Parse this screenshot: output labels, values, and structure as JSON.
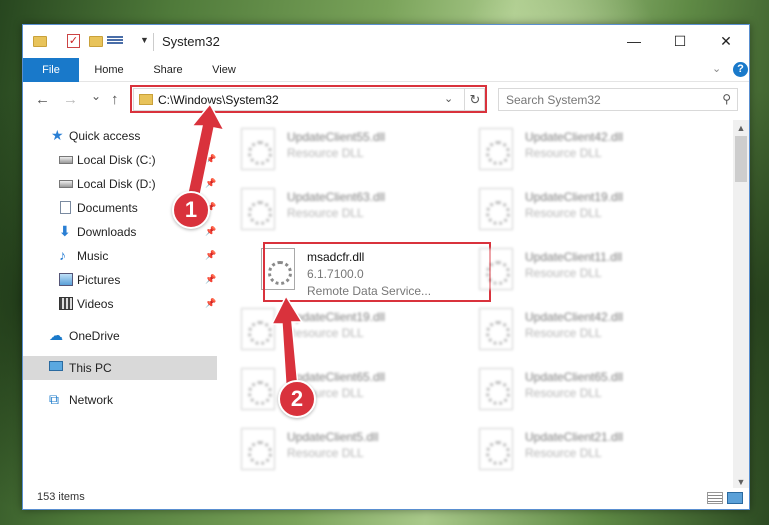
{
  "window": {
    "title": "System32",
    "minimize": "—",
    "maximize": "☐",
    "close": "✕"
  },
  "ribbon": {
    "tabs": [
      "File",
      "Home",
      "Share",
      "View"
    ],
    "help": "?"
  },
  "nav": {
    "back": "←",
    "forward": "→",
    "recent": "⌄",
    "up": "↑",
    "address": "C:\\Windows\\System32",
    "search_placeholder": "Search System32"
  },
  "sidebar": {
    "items": [
      {
        "label": "Quick access",
        "icon": "star-icon",
        "pinned": false
      },
      {
        "label": "Local Disk (C:)",
        "icon": "disk-icon",
        "pinned": true
      },
      {
        "label": "Local Disk (D:)",
        "icon": "disk-icon",
        "pinned": true
      },
      {
        "label": "Documents",
        "icon": "document-icon",
        "pinned": true
      },
      {
        "label": "Downloads",
        "icon": "download-icon",
        "pinned": true
      },
      {
        "label": "Music",
        "icon": "music-icon",
        "pinned": true
      },
      {
        "label": "Pictures",
        "icon": "pictures-icon",
        "pinned": true
      },
      {
        "label": "Videos",
        "icon": "videos-icon",
        "pinned": true
      },
      {
        "label": "OneDrive",
        "icon": "cloud-icon",
        "pinned": false
      },
      {
        "label": "This PC",
        "icon": "computer-icon",
        "pinned": false,
        "selected": true
      },
      {
        "label": "Network",
        "icon": "network-icon",
        "pinned": false
      }
    ]
  },
  "files": [
    {
      "name": "UpdateClient55.dll",
      "desc": "Resource DLL",
      "blurred": true
    },
    {
      "name": "UpdateClient42.dll",
      "desc": "Resource DLL",
      "blurred": true
    },
    {
      "name": "UpdateClient63.dll",
      "desc": "Resource DLL",
      "blurred": true
    },
    {
      "name": "UpdateClient19.dll",
      "desc": "Resource DLL",
      "blurred": true
    },
    {
      "name": "msadcfr.dll",
      "version": "6.1.7100.0",
      "desc": "Remote Data Service...",
      "blurred": false
    },
    {
      "name": "UpdateClient11.dll",
      "desc": "Resource DLL",
      "blurred": true
    },
    {
      "name": "UpdateClient19.dll",
      "desc": "Resource DLL",
      "blurred": true
    },
    {
      "name": "UpdateClient42.dll",
      "desc": "Resource DLL",
      "blurred": true
    },
    {
      "name": "UpdateClient65.dll",
      "desc": "Resource DLL",
      "blurred": true
    },
    {
      "name": "UpdateClient65.dll",
      "desc": "Resource DLL",
      "blurred": true
    },
    {
      "name": "UpdateClient5.dll",
      "desc": "Resource DLL",
      "blurred": true
    },
    {
      "name": "UpdateClient21.dll",
      "desc": "Resource DLL",
      "blurred": true
    }
  ],
  "status": {
    "item_count": "153 items"
  },
  "annotations": {
    "step1": "1",
    "step2": "2",
    "color": "#d9323c"
  }
}
